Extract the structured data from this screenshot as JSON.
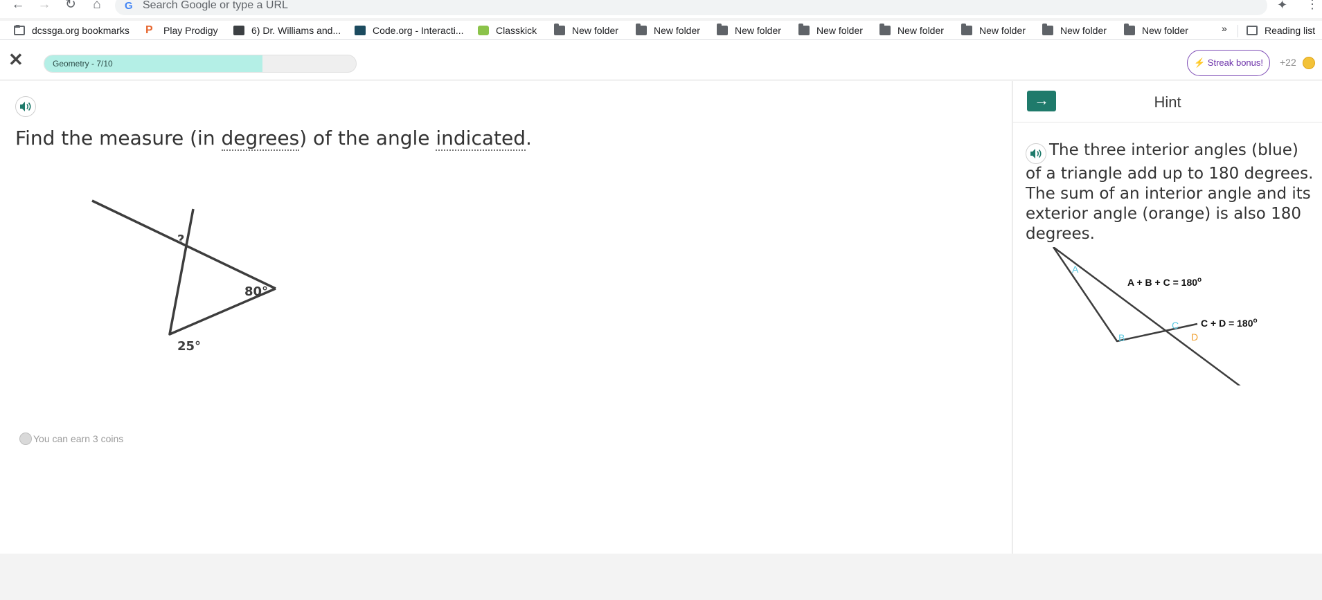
{
  "browser": {
    "url_placeholder": "Search Google or type a URL",
    "g_logo": "G",
    "bookmarks": [
      {
        "label": "dcssga.org bookmarks",
        "icon": "bookmarks-folder-icon"
      },
      {
        "label": "Play Prodigy",
        "icon": "prodigy-icon"
      },
      {
        "label": "6) Dr. Williams and...",
        "icon": "classroom-icon"
      },
      {
        "label": "Code.org - Interacti...",
        "icon": "codeorg-icon"
      },
      {
        "label": "Classkick",
        "icon": "classkick-icon"
      },
      {
        "label": "New folder",
        "icon": "folder-icon"
      },
      {
        "label": "New folder",
        "icon": "folder-icon"
      },
      {
        "label": "New folder",
        "icon": "folder-icon"
      },
      {
        "label": "New folder",
        "icon": "folder-icon"
      },
      {
        "label": "New folder",
        "icon": "folder-icon"
      },
      {
        "label": "New folder",
        "icon": "folder-icon"
      },
      {
        "label": "New folder",
        "icon": "folder-icon"
      },
      {
        "label": "New folder",
        "icon": "folder-icon"
      }
    ],
    "overflow": "»",
    "reading_list": "Reading list"
  },
  "header": {
    "progress_label": "Geometry - 7/10",
    "progress_fraction": 0.7,
    "streak_label": "⚡ Streak bonus!",
    "coins": "+22",
    "accent": "#b4efe6"
  },
  "question": {
    "prefix": "Find the measure (in ",
    "term1": "degrees",
    "middle": ") of the angle ",
    "term2": "indicated",
    "suffix": ".",
    "earn": "You can earn 3 coins",
    "figure": {
      "unknown": "?",
      "angle_top": "80°",
      "angle_bottom": "25°"
    }
  },
  "hint": {
    "title": "Hint",
    "text": "The three interior angles (blue) of a triangle add up to 180 degrees. The sum of an interior angle and its exterior angle (orange) is also 180 degrees.",
    "figure": {
      "a": "A",
      "b": "B",
      "c": "C",
      "d": "D",
      "eq1": "A + B + C = 180",
      "eq2": "C + D = 180",
      "degree": "o",
      "interior_color": "#5bc8e0",
      "exterior_color": "#f0a030"
    }
  }
}
